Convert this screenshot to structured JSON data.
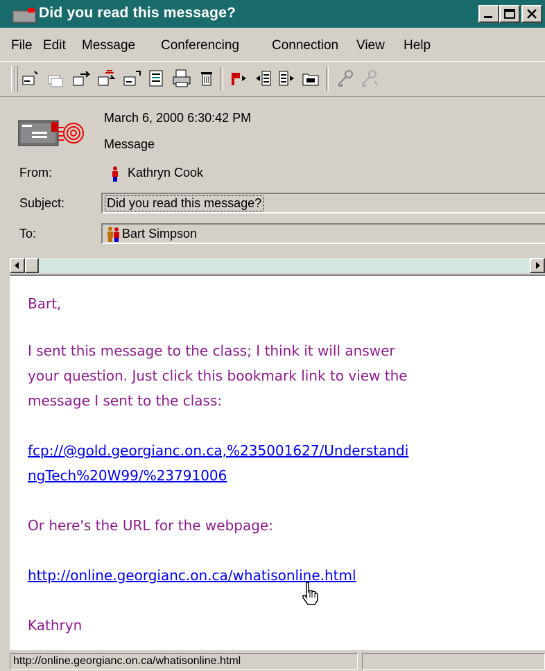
{
  "window": {
    "title": "Did you read this message?",
    "colors": {
      "titlebar": "#1a6b6b",
      "body_text": "#8b1c8b",
      "link": "#0000ee",
      "chrome": "#d4d0c8"
    }
  },
  "menu": [
    "File",
    "Edit",
    "Message",
    "Conferencing",
    "Connection",
    "View",
    "Help"
  ],
  "toolbar": {
    "tools": [
      "reply-icon",
      "reply-all-icon",
      "forward-icon",
      "forward-all-icon",
      "new-message-icon",
      "print-preview-icon",
      "print-icon",
      "delete-icon",
      "flag-icon",
      "previous-icon",
      "next-icon",
      "open-folder-icon",
      "key-icon",
      "key-disabled-icon"
    ]
  },
  "header": {
    "date": "March 6, 2000 6:30:42 PM",
    "type": "Message",
    "from_label": "From:",
    "from_name": "Kathryn Cook",
    "subject_label": "Subject:",
    "subject": "Did you read this message?",
    "to_label": "To:",
    "to_name": "Bart Simpson"
  },
  "body": {
    "greeting": "Bart,",
    "line1": "I sent this message to the class; I think it will answer",
    "line2": "your question.  Just click this bookmark link to view the",
    "line3": "message I sent to the class:",
    "link1_line1": "fcp://@gold.georgianc.on.ca,%235001627/Understandi",
    "link1_line2": "ngTech%20W99/%23791006",
    "line4": "Or here's the URL for the webpage:",
    "link2": "http://online.georgianc.on.ca/whatisonline.html",
    "signature": "Kathryn"
  },
  "status": {
    "text": "http://online.georgianc.on.ca/whatisonline.html"
  }
}
